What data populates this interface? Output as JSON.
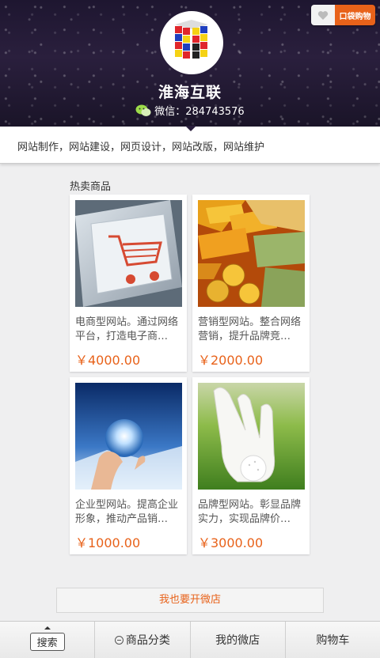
{
  "header": {
    "shop_name": "淮海互联",
    "wechat_label": "微信：284743576",
    "pocket_badge": "口袋购物"
  },
  "intro": {
    "text": "网站制作，网站建设，网页设计，网站改版，网站维护"
  },
  "section": {
    "title": "热卖商品"
  },
  "products": [
    {
      "desc": "电商型网站。通过网络平台，打造电子商…",
      "price": "￥4000.00",
      "image": "shopping-cart-key"
    },
    {
      "desc": "营销型网站。整合网络营销，提升品牌竞…",
      "price": "￥2000.00",
      "image": "gold-bars-money"
    },
    {
      "desc": "企业型网站。提高企业形象，推动产品销…",
      "price": "￥1000.00",
      "image": "hand-globe"
    },
    {
      "desc": "品牌型网站。彰显品牌实力，实现品牌价…",
      "price": "￥3000.00",
      "image": "golf-glove"
    }
  ],
  "open_store_label": "我也要开微店",
  "bottom_nav": {
    "search": "搜索",
    "categories": "商品分类",
    "my_store": "我的微店",
    "cart": "购物车"
  },
  "colors": {
    "accent": "#e8621a",
    "header_bg": "#1e1630"
  }
}
